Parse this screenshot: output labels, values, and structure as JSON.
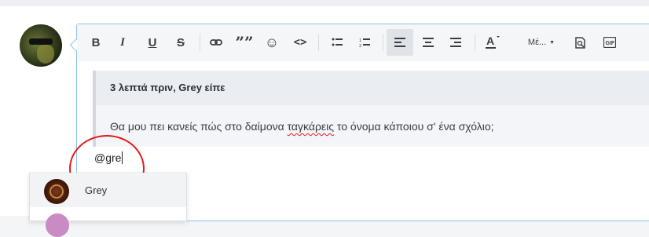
{
  "editor": {
    "toolbar": {
      "bold": "B",
      "italic": "I",
      "underline": "U",
      "strike": "S",
      "quote": "””",
      "smilie": "☺",
      "code": "<>",
      "font_size_label": "Μέ...",
      "active": "align-left"
    },
    "quote": {
      "header": "3 λεπτά πριν, Grey είπε",
      "body_before": "Θα μου πει κανείς πώς στο δαίμονα ",
      "body_misspelled": "ταγκάρεις",
      "body_after": " το όνομα κάποιου σ' ένα σχόλιο;"
    },
    "typed_text": "@gre"
  },
  "mention_dropdown": {
    "items": [
      {
        "name": "Grey"
      }
    ]
  },
  "colors": {
    "focus_border": "#8fc3ea",
    "highlight_circle": "#e01b1b",
    "spellcheck": "#e02020"
  }
}
